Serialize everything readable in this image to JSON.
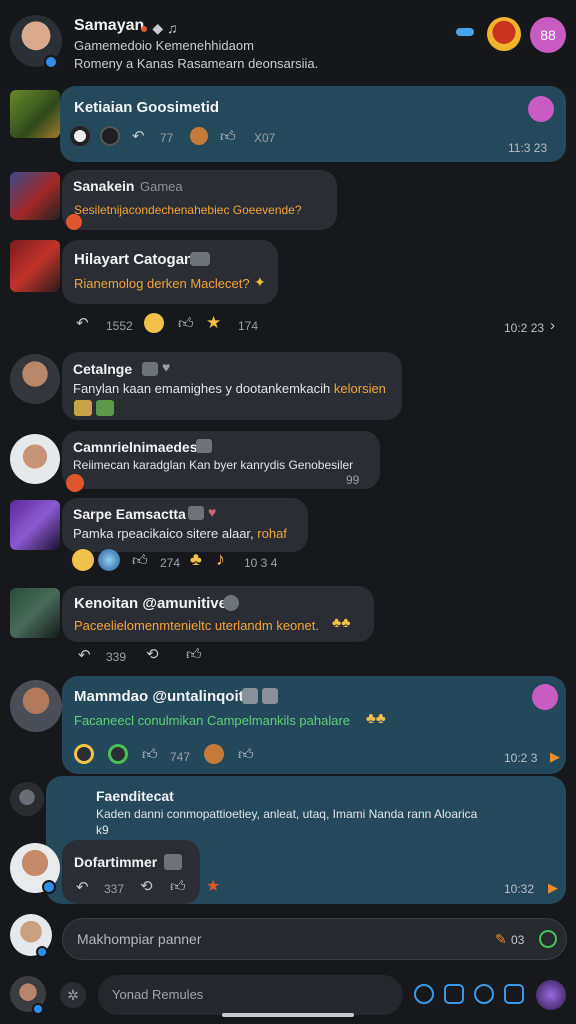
{
  "header": {
    "title": "Samayan",
    "line1": "Gamemedoio Kemenehhidaom",
    "line2": "Romeny a Kanas Rasamearn deonsarsiia.",
    "pill_label": "88"
  },
  "messages": [
    {
      "title": "Ketiaian Goosimetid",
      "react_counts": [
        "77",
        "X07"
      ],
      "time": "11:3 23"
    },
    {
      "title": "Sanakein",
      "title_extra": "Gamea",
      "text": "Sesiletnijacondechenahebiec Goeevende?"
    },
    {
      "title": "Hilayart Catogan",
      "text": "Rianemolog derken Maclecet?",
      "react_counts": [
        "1552",
        "174"
      ],
      "time": "10:2 23"
    },
    {
      "title": "Cetalnge",
      "text_w": "Fanylan kaan emamighes y dootankemkacih",
      "text_o": "kelorsien"
    },
    {
      "title": "Camnrielnimaedes",
      "text": "Reiimecan karadglan Kan byer kanrydis Genobesiler",
      "count": "99"
    },
    {
      "title": "Sarpe Eamsactta",
      "text_w": "Pamka rpeacikaico sitere alaar,",
      "text_o": "rohaf",
      "react_counts": [
        "274",
        "10 3 4"
      ]
    },
    {
      "title": "Kenoitan @amunitive",
      "text": "Paceelielomenmtenieltc uterlandm keonet.",
      "react_counts": [
        "339"
      ]
    },
    {
      "title": "Mammdao @untalinqoito",
      "text": "Facaneecl conulmikan Campelmankils pahalare",
      "react_counts": [
        "747"
      ],
      "time": "10:2 3"
    },
    {
      "title": "Faenditecat",
      "text": "Kaden danni conmopattioetiey, anleat, utaq, Imami Nanda rann Aloarica",
      "text2": "k9"
    },
    {
      "title": "Dofartimmer",
      "react_counts": [
        "337"
      ],
      "time": "10:32"
    }
  ],
  "composer": {
    "placeholder": "Makhompiar panner",
    "count": "03"
  },
  "bottom": {
    "placeholder": "Yonad Remules"
  },
  "colors": {
    "bg": "#16181c",
    "bubble_dark": "#2a2d33",
    "bubble_teal": "#23495a",
    "accent_orange": "#f0a53a",
    "accent_green": "#5fd07a",
    "pill": "#c85cc2"
  }
}
